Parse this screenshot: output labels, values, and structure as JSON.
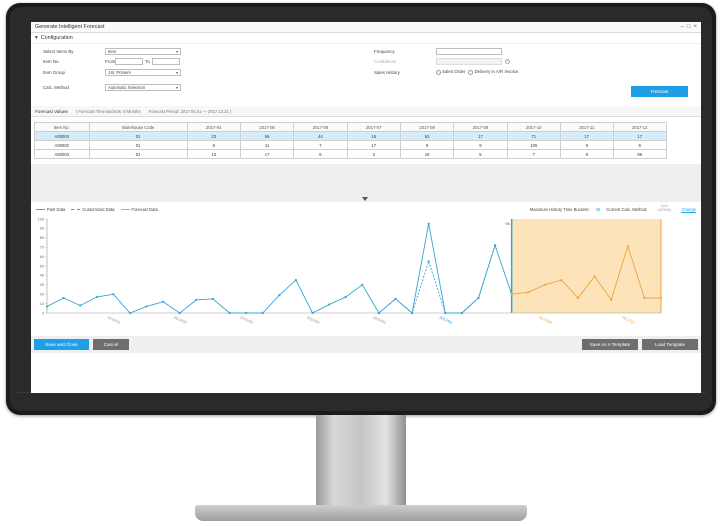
{
  "window": {
    "title": "Generate Intelligent Forecast"
  },
  "config": {
    "heading": "Configuration",
    "select_items_by": {
      "label": "Select Items By",
      "value": "Item"
    },
    "item_no": {
      "label": "Item No.",
      "from": "From",
      "to": "To"
    },
    "item_group": {
      "label": "Item Group",
      "value": "J.B. Printers"
    },
    "calc_method": {
      "label": "Calc. Method",
      "value": "Automatic Selection"
    },
    "frequency": {
      "label": "Frequency"
    },
    "third_label": {
      "label": "Confidence"
    },
    "sales_history": {
      "label": "Sales History",
      "opt1": "Sales Order",
      "opt2": "Delivery in A/R Invoice"
    },
    "forecast_button": "Forecast"
  },
  "forecast_values": {
    "title": "Forecast Values",
    "time_buckets": "( Forecast Time Buckets: 9 Months",
    "period": "Forecast Period: 2017.04.01 — 2017.12.31 )",
    "columns": [
      "Item No.",
      "Warehouse Code",
      "2017-04",
      "2017-05",
      "2017-06",
      "2017-07",
      "2017-08",
      "2017-09",
      "2017-10",
      "2017-11",
      "2017-12"
    ],
    "rows": [
      [
        "A00004",
        "01",
        "23",
        "56",
        "44",
        "16",
        "62",
        "17",
        "71",
        "17",
        "17"
      ],
      [
        "A00002",
        "01",
        "6",
        "11",
        "7",
        "17",
        "9",
        "9",
        "105",
        "9",
        "6"
      ],
      [
        "A00003",
        "01",
        "13",
        "17",
        "6",
        "3",
        "16",
        "5",
        "7",
        "8",
        "95"
      ]
    ],
    "selected_row": 0
  },
  "chart_options": {
    "max_history_label": "Maximum History Time Buckets:",
    "max_history_value": "36",
    "current_calc_label": "Current Calc. Method:",
    "current_calc_value": "Auto (ARIMA)",
    "change_link": "Change"
  },
  "chart_data": {
    "type": "line",
    "legend": [
      "Past Data",
      "Customized Data",
      "Forecast Data"
    ],
    "ylim": [
      0,
      100
    ],
    "yticks": [
      0,
      10,
      20,
      30,
      40,
      50,
      60,
      70,
      80,
      90,
      100
    ],
    "xlabels": [
      "2014/03",
      "2014/09",
      "2015/03",
      "2015/09",
      "2016/03",
      "2017/03",
      "2017/09",
      "2017/12"
    ],
    "series": [
      {
        "name": "Past Data",
        "values": [
          7,
          16,
          8,
          17,
          20,
          0,
          7,
          12,
          0,
          14,
          15,
          0,
          0,
          0,
          19,
          35,
          0,
          9,
          17,
          30,
          0,
          15,
          0,
          95,
          0,
          0,
          16,
          72,
          20
        ]
      },
      {
        "name": "Customized Data",
        "values": [
          null,
          null,
          null,
          null,
          null,
          null,
          null,
          null,
          null,
          null,
          null,
          null,
          null,
          null,
          null,
          null,
          null,
          null,
          null,
          null,
          0,
          15,
          0,
          55,
          0,
          0,
          16,
          72,
          null
        ]
      },
      {
        "name": "Forecast Data",
        "values": [
          null,
          null,
          null,
          null,
          null,
          null,
          null,
          null,
          null,
          null,
          null,
          null,
          null,
          null,
          null,
          null,
          null,
          null,
          null,
          null,
          null,
          null,
          null,
          null,
          null,
          null,
          null,
          null,
          20,
          22,
          30,
          35,
          16,
          39,
          14,
          71,
          16,
          16
        ]
      }
    ],
    "forecast_start_value": 95
  },
  "footer": {
    "save_close": "Save and Close",
    "cancel": "Cancel",
    "save_template": "Save As A Template",
    "load_template": "Load Template"
  }
}
